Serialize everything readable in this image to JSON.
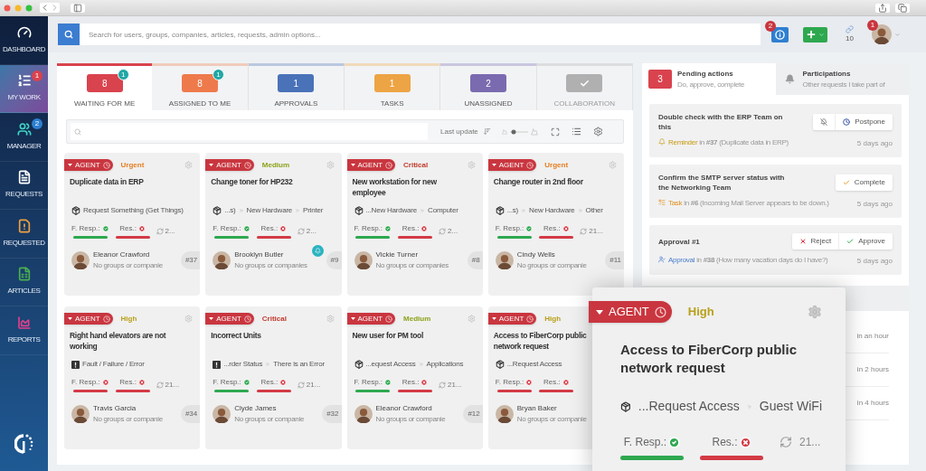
{
  "sidebar": {
    "items": [
      {
        "label": "DASHBOARD",
        "kind": "dashboard",
        "selected": false
      },
      {
        "label": "MY WORK",
        "kind": "mywork",
        "selected": true,
        "badge": "1",
        "color": "#d9434e"
      },
      {
        "label": "MANAGER",
        "kind": "manager",
        "selected": false,
        "badge": "2",
        "color": "#2d7fd0"
      },
      {
        "label": "REQUESTS",
        "kind": "requests",
        "selected": false
      },
      {
        "label": "REQUESTED",
        "kind": "requested",
        "selected": false
      },
      {
        "label": "ARTICLES",
        "kind": "articles",
        "selected": false
      },
      {
        "label": "REPORTS",
        "kind": "reports",
        "selected": false
      }
    ]
  },
  "top_bar": {
    "search": {
      "placeholder": "Search for users, groups, companies, articles, requests, admin options..."
    },
    "info_badge": "2",
    "links_count": "10",
    "avatar_badge": "1"
  },
  "tabs": [
    {
      "kind": "count",
      "count": "8",
      "label": "WAITING FOR ME",
      "selected": true,
      "disabled": false,
      "color": "#d9434e",
      "badge": "1"
    },
    {
      "kind": "count",
      "count": "8",
      "label": "ASSIGNED TO ME",
      "selected": false,
      "disabled": false,
      "color": "#ee7a4c",
      "badge": "1"
    },
    {
      "kind": "count",
      "count": "1",
      "label": "APPROVALS",
      "selected": false,
      "disabled": false,
      "color": "#4a72b8"
    },
    {
      "kind": "count",
      "count": "1",
      "label": "TASKS",
      "selected": false,
      "disabled": false,
      "color": "#eda444"
    },
    {
      "kind": "count",
      "count": "2",
      "label": "UNASSIGNED",
      "selected": false,
      "disabled": false,
      "color": "#7a6bb0"
    },
    {
      "kind": "check",
      "label": "COLLABORATION",
      "selected": false,
      "disabled": true,
      "color": "#b0b0b0"
    }
  ],
  "toolbar": {
    "sort_label": "Last update"
  },
  "cards": [
    {
      "agent": "AGENT",
      "priority": {
        "label": "Urgent",
        "color": "#e67e22"
      },
      "title": "Duplicate data in ERP",
      "kind": "request",
      "crumbs": [
        "Request Something (Get Things)"
      ],
      "f_resp_label": "F. Resp.:",
      "f_resp_met": true,
      "res_label": "Res.:",
      "res_met": false,
      "refresh": "2...",
      "name": "Eleanor Crawford",
      "org": "No groups or companie",
      "id": "#37",
      "notification": false,
      "gear": true
    },
    {
      "agent": "AGENT",
      "priority": {
        "label": "Medium",
        "color": "#8aa31a"
      },
      "title": "Change toner for HP232",
      "kind": "request",
      "crumbs": [
        "...s)",
        "New Hardware",
        "Printer"
      ],
      "f_resp_label": "F. Resp.:",
      "f_resp_met": true,
      "res_label": "Res.:",
      "res_met": false,
      "refresh": "2...",
      "name": "Brooklyn Butler",
      "org": "No groups or companies",
      "id": "#9",
      "notification": true,
      "gear": true
    },
    {
      "agent": "AGENT",
      "priority": {
        "label": "Critical",
        "color": "#c0392b"
      },
      "title": "New workstation for new employee",
      "kind": "request",
      "crumbs": [
        "...New Hardware",
        "Computer"
      ],
      "f_resp_label": "F. Resp.:",
      "f_resp_met": true,
      "res_label": "Res.:",
      "res_met": false,
      "refresh": "2...",
      "name": "Vickie Turner",
      "org": "No groups or companies",
      "id": "#8",
      "notification": false,
      "gear": true
    },
    {
      "agent": "AGENT",
      "priority": {
        "label": "Urgent",
        "color": "#e67e22"
      },
      "title": "Change router in 2nd floor",
      "kind": "request",
      "crumbs": [
        "...s)",
        "New Hardware",
        "Other"
      ],
      "f_resp_label": "F. Resp.:",
      "f_resp_met": true,
      "res_label": "Res.:",
      "res_met": false,
      "refresh": "21...",
      "name": "Cindy Wells",
      "org": "No groups or companie",
      "id": "#11",
      "notification": false,
      "gear": true
    },
    {
      "agent": "AGENT",
      "priority": {
        "label": "High",
        "color": "#b8a01a"
      },
      "title": "Right hand elevators are not working",
      "kind": "fault",
      "crumbs": [
        "Fault / Failure / Error"
      ],
      "f_resp_label": "F. Resp.:",
      "f_resp_met": false,
      "res_label": "Res.:",
      "res_met": false,
      "refresh": "21...",
      "name": "Travis Garcia",
      "org": "No groups or companie",
      "id": "#34",
      "notification": false,
      "gear": true
    },
    {
      "agent": "AGENT",
      "priority": {
        "label": "Critical",
        "color": "#c0392b"
      },
      "title": "Incorrect Units",
      "kind": "fault",
      "crumbs": [
        "...rder Status",
        "There is an Error"
      ],
      "f_resp_label": "F. Resp.:",
      "f_resp_met": true,
      "res_label": "Res.:",
      "res_met": false,
      "refresh": "21...",
      "name": "Clyde James",
      "org": "No groups or companie",
      "id": "#32",
      "notification": false,
      "gear": true
    },
    {
      "agent": "AGENT",
      "priority": {
        "label": "Medium",
        "color": "#8aa31a"
      },
      "title": "New user for PM tool",
      "kind": "request",
      "crumbs": [
        "...equest Access",
        "Applications"
      ],
      "f_resp_label": "F. Resp.:",
      "f_resp_met": true,
      "res_label": "Res.:",
      "res_met": false,
      "refresh": "21...",
      "name": "Eleanor Crawford",
      "org": "No groups or companie",
      "id": "#12",
      "notification": false,
      "gear": true
    },
    {
      "agent": "AGENT",
      "priority": {
        "label": "High",
        "color": "#b8a01a"
      },
      "title": "Access to FiberCorp public network request",
      "kind": "request",
      "crumbs": [
        "...Request Access"
      ],
      "f_resp_label": "F. Resp.:",
      "f_resp_met": false,
      "res_label": "Res.:",
      "res_met": false,
      "name": "Bryan Baker",
      "org": "No groups or companie"
    }
  ],
  "actions_panel": {
    "tabs": [
      {
        "kind": "count",
        "count": "3",
        "title": "Pending actions",
        "subtitle": "Do, approve, complete",
        "selected": true
      },
      {
        "kind": "bell",
        "title": "Participations",
        "subtitle": "Other requests I take part of",
        "selected": false
      }
    ],
    "items": [
      {
        "title": "Double check with the ERP Team on this",
        "buttons": [
          {
            "kind": "mute"
          },
          {
            "kind": "postpone",
            "label": "Postpone"
          }
        ],
        "kind": "reminder",
        "meta_link": "Reminder",
        "meta_text": "in **#37** (Duplicate data in ERP)",
        "time": "5 days ago"
      },
      {
        "title": "Confirm the SMTP server status with the Networking Team",
        "buttons": [
          {
            "kind": "complete",
            "label": "Complete"
          }
        ],
        "kind": "task",
        "meta_link": "Task",
        "meta_text": "in **#6** (Incoming Mail Server appears to be down.)",
        "time": "5 days ago"
      },
      {
        "title": "Approval #1",
        "buttons": [
          {
            "kind": "reject",
            "label": "Reject"
          },
          {
            "kind": "approve",
            "label": "Approve"
          }
        ],
        "kind": "approval",
        "meta_link": "Approval",
        "meta_text": "in **#38** (How many vacation days do I have?)",
        "time": "5 days ago"
      }
    ],
    "upcoming": [
      {
        "time": "in an hour"
      },
      {
        "time": "in 2 hours"
      },
      {
        "time": "in 4 hours"
      }
    ]
  },
  "zoomed_card": {
    "agent": "AGENT",
    "priority": {
      "label": "High",
      "color": "#b8a01a"
    },
    "title": "Access to FiberCorp public network request",
    "crumbs": [
      "...Request Access",
      "Guest WiFi"
    ],
    "f_resp_label": "F. Resp.:",
    "f_resp_met": true,
    "res_label": "Res.:",
    "res_met": false,
    "refresh": "21..."
  }
}
